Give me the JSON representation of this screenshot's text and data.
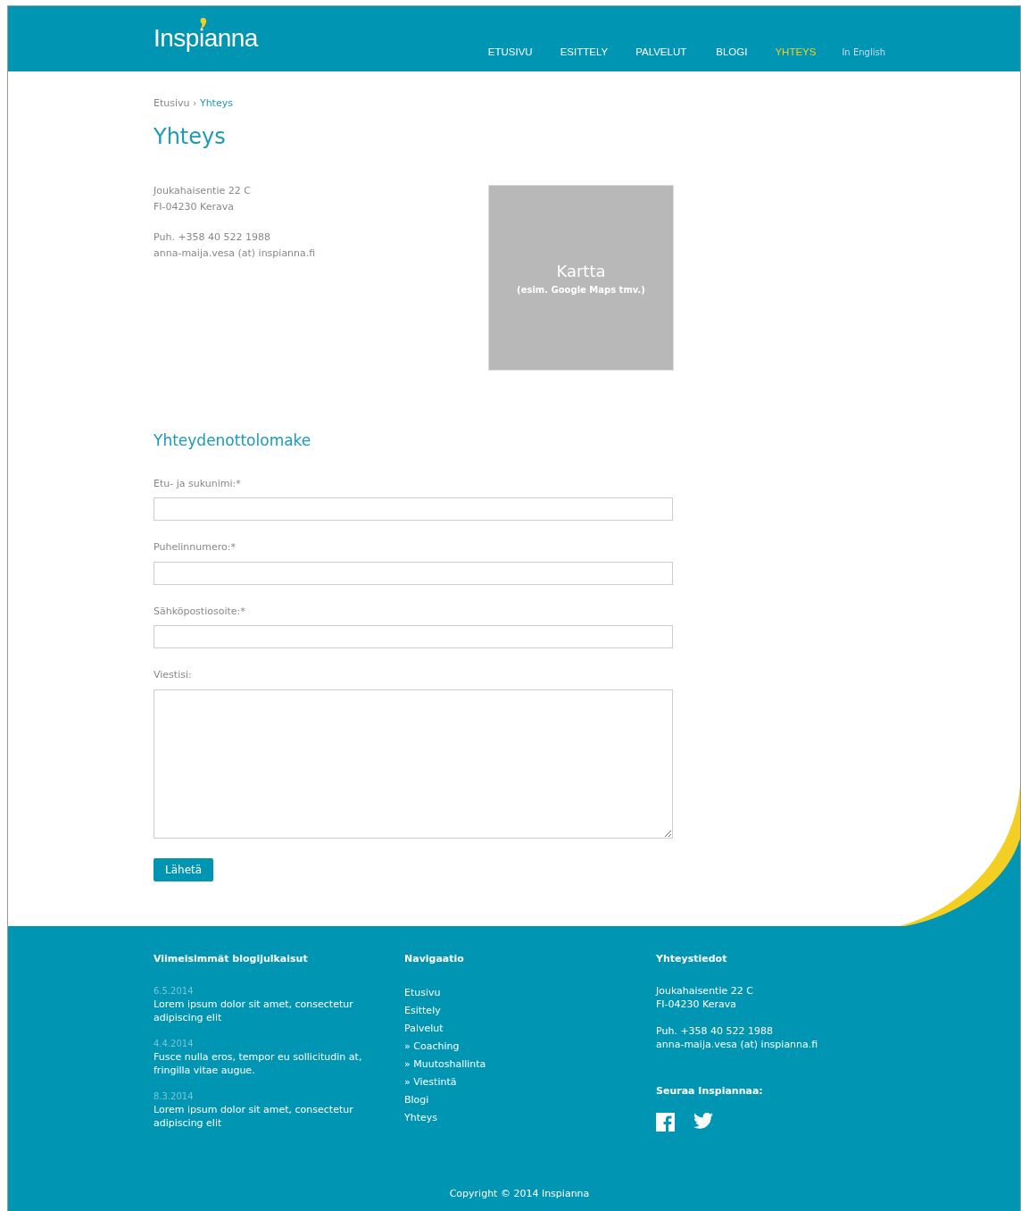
{
  "header": {
    "logo": "Inspianna",
    "nav": [
      {
        "label": "ETUSIVU",
        "selected": false
      },
      {
        "label": "ESITTELY",
        "selected": false
      },
      {
        "label": "PALVELUT",
        "selected": false
      },
      {
        "label": "BLOGI",
        "selected": false
      },
      {
        "label": "YHTEYS",
        "selected": true
      }
    ],
    "language_link": "In English"
  },
  "breadcrumb": [
    {
      "label": "Etusivu",
      "selected": false
    },
    {
      "label": "Yhteys",
      "selected": true
    }
  ],
  "breadcrumb_separator": "›",
  "title": "Yhteys",
  "address": [
    "Joukahaisentie 22 C",
    "FI-04230 Kerava"
  ],
  "contact": [
    "Puh. +358 40 522 1988",
    "anna-maija.vesa (at) inspianna.fi"
  ],
  "map": {
    "title": "Kartta",
    "subtitle": "(esim. Google Maps tmv.)"
  },
  "form": {
    "title": "Yhteydenottolomake",
    "fields": [
      {
        "label": "Etu- ja sukunimi:*",
        "kind": "input"
      },
      {
        "label": "Puhelinnumero:*",
        "kind": "input"
      },
      {
        "label": "Sähköpostiosoite:*",
        "kind": "input"
      },
      {
        "label": "Viestisi:",
        "kind": "textarea"
      }
    ],
    "submit": "Lähetä"
  },
  "footer": {
    "blog": {
      "title": "Viimeisimmät blogijulkaisut",
      "posts": [
        {
          "date": "6.5.2014",
          "text": "Lorem ipsum dolor sit amet, consectetur adipiscing elit"
        },
        {
          "date": "4.4.2014",
          "text": "Fusce nulla eros, tempor eu sollicitudin at, fringilla vitae augue."
        },
        {
          "date": "8.3.2014",
          "text": "Lorem ipsum dolor sit amet, consectetur adipiscing elit"
        }
      ]
    },
    "navigation": {
      "title": "Navigaatio",
      "links": [
        "Etusivu",
        "Esittely",
        "Palvelut",
        "» Coaching",
        "» Muutoshallinta",
        "» Viestintä",
        "Blogi",
        "Yhteys"
      ]
    },
    "contact": {
      "title": "Yhteystiedot",
      "address": [
        "Joukahaisentie 22 C",
        "FI-04230 Kerava"
      ],
      "contact": [
        "Puh. +358 40 522 1988",
        "anna-maija.vesa (at) inspianna.fi"
      ],
      "follow_title": "Seuraa Inspiannaa:",
      "social": [
        {
          "kind": "facebook"
        },
        {
          "kind": "twitter"
        }
      ]
    },
    "copyright": "Copyright © 2014 Inspianna"
  }
}
